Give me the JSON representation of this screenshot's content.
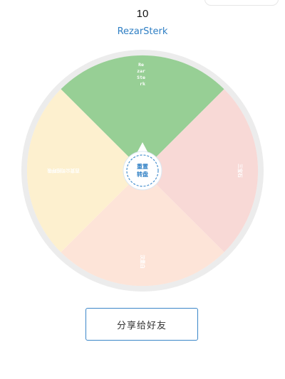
{
  "header": {
    "count": "10",
    "result": "RezarSterk"
  },
  "wheel": {
    "segments": [
      {
        "label": "Re zar Ste rk",
        "color": "#97cf95"
      },
      {
        "label": "三宝石",
        "color": "#f8d9d6"
      },
      {
        "label": "汉堡白",
        "color": "#fde4d8"
      },
      {
        "label": "百货公司招呼吸",
        "color": "#fdf0cf"
      }
    ],
    "center_label_line1": "重置",
    "center_label_line2": "转盘"
  },
  "share_button": {
    "label": "分享给好友"
  }
}
